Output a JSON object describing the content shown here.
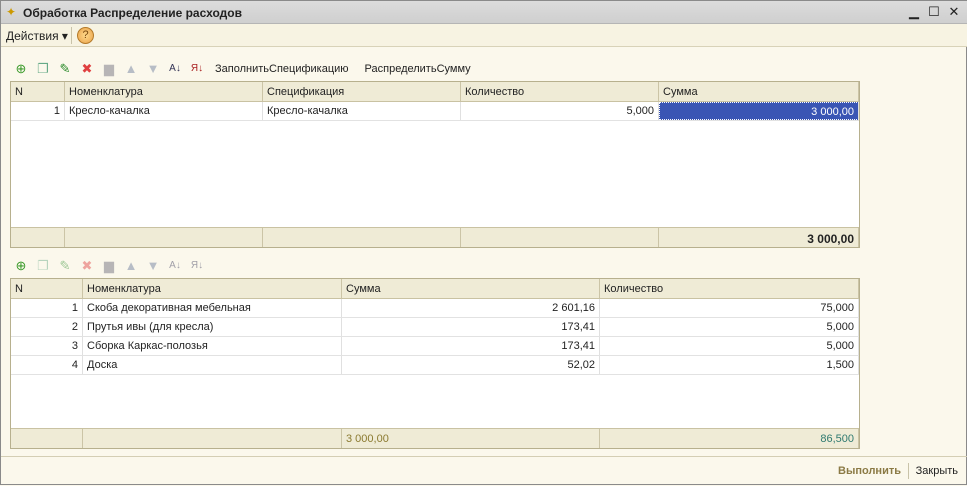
{
  "window": {
    "title": "Обработка  Распределение расходов"
  },
  "menu": {
    "actions": "Действия ▾",
    "help": "?"
  },
  "top_toolbar": {
    "fill_spec": "ЗаполнитьСпецификацию",
    "distribute_sum": "РаспределитьСумму"
  },
  "top_table": {
    "columns": [
      "N",
      "Номенклатура",
      "Спецификация",
      "Количество",
      "Сумма"
    ],
    "rows": [
      {
        "n": "1",
        "item": "Кресло-качалка",
        "spec": "Кресло-качалка",
        "qty": "5,000",
        "sum": "3 000,00"
      }
    ],
    "total_sum": "3 000,00"
  },
  "bottom_table": {
    "columns": [
      "N",
      "Номенклатура",
      "Сумма",
      "Количество"
    ],
    "rows": [
      {
        "n": "1",
        "item": "Скоба декоративная мебельная",
        "sum": "2 601,16",
        "qty": "75,000"
      },
      {
        "n": "2",
        "item": "Прутья ивы (для кресла)",
        "sum": "173,41",
        "qty": "5,000"
      },
      {
        "n": "3",
        "item": "Сборка Каркас-полозья",
        "sum": "173,41",
        "qty": "5,000"
      },
      {
        "n": "4",
        "item": "Доска",
        "sum": "52,02",
        "qty": "1,500"
      }
    ],
    "total_sum": "3 000,00",
    "total_qty": "86,500"
  },
  "footer": {
    "run": "Выполнить",
    "close": "Закрыть"
  }
}
